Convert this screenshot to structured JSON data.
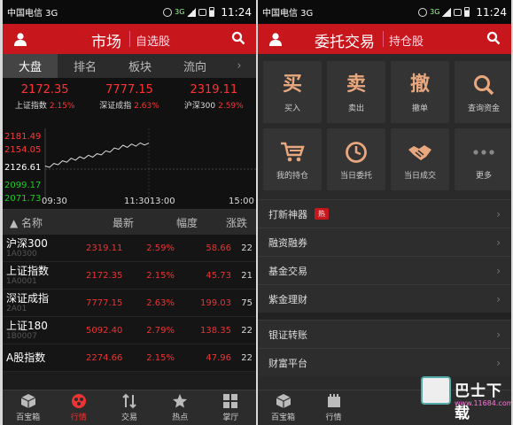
{
  "status": {
    "carrier": "中国电信 3G",
    "time": "11:24",
    "net_top": "3G",
    "net_bottom": "2G"
  },
  "left": {
    "title": "市场",
    "subtitle": "自选股",
    "tabs": [
      "大盘",
      "排名",
      "板块",
      "流向"
    ],
    "tab_more": "›",
    "indices": [
      {
        "value": "2172.35",
        "name": "上证指数",
        "pct": "2.15%"
      },
      {
        "value": "7777.15",
        "name": "深证成指",
        "pct": "2.63%"
      },
      {
        "value": "2319.11",
        "name": "沪深300",
        "pct": "2.59%"
      }
    ],
    "chart_y_labels": [
      {
        "text": "2181.49",
        "color": "#ff3b3b"
      },
      {
        "text": "2154.05",
        "color": "#ff3b3b"
      },
      {
        "text": "2126.61",
        "color": "#ffffff"
      },
      {
        "text": "2099.17",
        "color": "#22cc22"
      },
      {
        "text": "2071.73",
        "color": "#22cc22"
      }
    ],
    "chart_x_labels": [
      "09:30",
      "11:3013:00",
      "15:00"
    ],
    "table_header": {
      "name": "名称",
      "latest": "最新",
      "pct": "幅度",
      "change": "涨跌"
    },
    "rows": [
      {
        "name": "沪深300",
        "code": "1A0300",
        "latest": "2319.11",
        "pct": "2.59%",
        "change": "58.66",
        "extra": "22"
      },
      {
        "name": "上证指数",
        "code": "1A0001",
        "latest": "2172.35",
        "pct": "2.15%",
        "change": "45.73",
        "extra": "21"
      },
      {
        "name": "深证成指",
        "code": "2A01",
        "latest": "7777.15",
        "pct": "2.63%",
        "change": "199.03",
        "extra": "75"
      },
      {
        "name": "上证180",
        "code": "1B0007",
        "latest": "5092.40",
        "pct": "2.79%",
        "change": "138.35",
        "extra": "22"
      },
      {
        "name": "A股指数",
        "code": "",
        "latest": "2274.66",
        "pct": "2.15%",
        "change": "47.96",
        "extra": "22"
      }
    ],
    "nav": [
      "百宝箱",
      "行情",
      "交易",
      "热点",
      "掌厅"
    ]
  },
  "right": {
    "title": "委托交易",
    "subtitle": "持仓股",
    "grid": [
      {
        "big": "买",
        "label": "买入"
      },
      {
        "big": "卖",
        "label": "卖出"
      },
      {
        "big": "撤",
        "label": "撤单"
      },
      {
        "icon": "search-icon",
        "label": "查询资金"
      },
      {
        "icon": "cart-icon",
        "label": "我的持仓"
      },
      {
        "icon": "clock-icon",
        "label": "当日委托"
      },
      {
        "icon": "handshake-icon",
        "label": "当日成交"
      },
      {
        "icon": "more-icon",
        "label": "更多"
      }
    ],
    "menu": [
      {
        "label": "打新神器",
        "badge": "热"
      },
      {
        "label": "融资融券"
      },
      {
        "label": "基金交易"
      },
      {
        "label": "紫金理财"
      },
      {
        "label": "银证转账"
      },
      {
        "label": "财富平台"
      }
    ],
    "nav": [
      "百宝箱",
      "行情"
    ],
    "watermark": {
      "title": "巴士下载",
      "url": "www.11684.com"
    }
  },
  "colors": {
    "accent": "#c8161d",
    "up": "#ff3b3b",
    "down": "#22cc22",
    "icon": "#e9a77e"
  },
  "chart_data": {
    "type": "line",
    "title": "",
    "ylim": [
      2071.73,
      2181.49
    ],
    "x": [
      "09:30",
      "10:00",
      "10:30",
      "11:00",
      "11:30"
    ],
    "series": [
      {
        "values": [
          2126.6,
          2140.1,
          2147.8,
          2162.5,
          2168.4
        ]
      }
    ]
  }
}
